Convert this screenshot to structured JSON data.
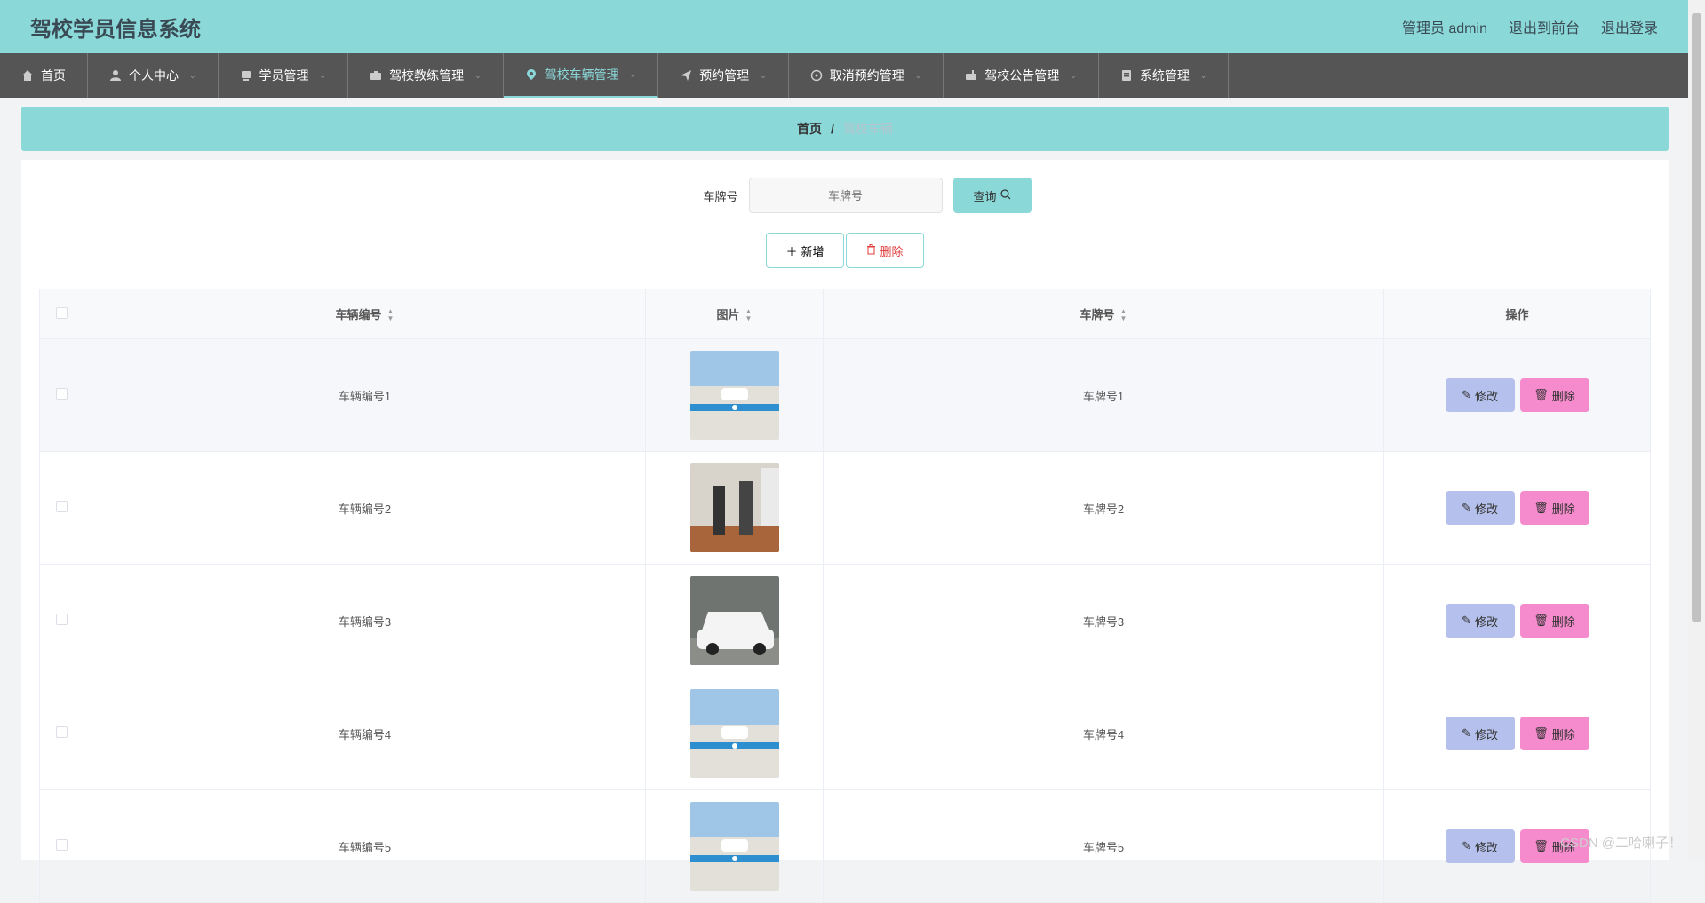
{
  "header": {
    "title": "驾校学员信息系统",
    "admin_label": "管理员 admin",
    "to_frontend": "退出到前台",
    "logout": "退出登录"
  },
  "nav": {
    "items": [
      {
        "label": "首页",
        "icon": "home-icon"
      },
      {
        "label": "个人中心",
        "icon": "user-icon"
      },
      {
        "label": "学员管理",
        "icon": "cup-icon"
      },
      {
        "label": "驾校教练管理",
        "icon": "briefcase-icon"
      },
      {
        "label": "驾校车辆管理",
        "icon": "location-icon"
      },
      {
        "label": "预约管理",
        "icon": "send-icon"
      },
      {
        "label": "取消预约管理",
        "icon": "compass-icon"
      },
      {
        "label": "驾校公告管理",
        "icon": "mailbox-icon"
      },
      {
        "label": "系统管理",
        "icon": "system-icon"
      }
    ],
    "active_index": 4
  },
  "breadcrumb": {
    "home": "首页",
    "separator": "/",
    "current": "驾校车辆"
  },
  "search": {
    "label": "车牌号",
    "placeholder": "车牌号",
    "query_button": "查询"
  },
  "actions": {
    "add": "新增",
    "delete": "删除"
  },
  "table": {
    "columns": [
      "车辆编号",
      "图片",
      "车牌号",
      "操作"
    ],
    "rows": [
      {
        "vehicle_no": "车辆编号1",
        "plate": "车牌号1",
        "edit": "修改",
        "delete": "删除"
      },
      {
        "vehicle_no": "车辆编号2",
        "plate": "车牌号2",
        "edit": "修改",
        "delete": "删除"
      },
      {
        "vehicle_no": "车辆编号3",
        "plate": "车牌号3",
        "edit": "修改",
        "delete": "删除"
      },
      {
        "vehicle_no": "车辆编号4",
        "plate": "车牌号4",
        "edit": "修改",
        "delete": "删除"
      },
      {
        "vehicle_no": "车辆编号5",
        "plate": "车牌号5",
        "edit": "修改",
        "delete": "删除"
      }
    ]
  },
  "watermark": "CSDN @二哈喇子！",
  "colors": {
    "accent": "#8bd8d9",
    "nav_bg": "#555555",
    "edit_bg": "#b5c1ec",
    "delete_bg": "#f58bcc"
  }
}
